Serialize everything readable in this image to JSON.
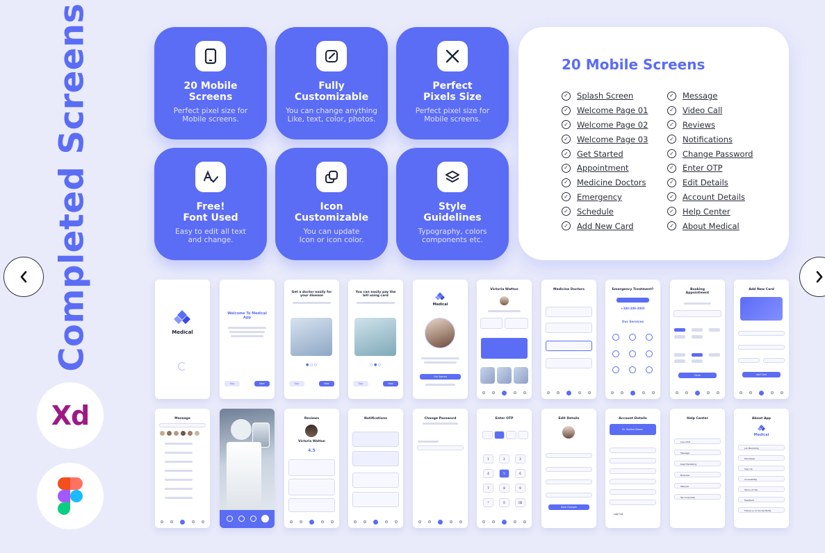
{
  "page_title": "Completed Screens",
  "nav": {
    "prev_symbol": "‹",
    "next_symbol": "›"
  },
  "tools": {
    "xd_label": "Xd"
  },
  "features": [
    {
      "title_line1": "20 Mobile",
      "title_line2": "Screens",
      "sub_line1": "Perfect pixel size for",
      "sub_line2": "Mobile screens.",
      "icon": "tablet-icon"
    },
    {
      "title_line1": "Fully",
      "title_line2": "Customizable",
      "sub_line1": "You can change anything",
      "sub_line2": "Like, text, color, photos.",
      "icon": "edit-icon"
    },
    {
      "title_line1": "Perfect",
      "title_line2": "Pixels Size",
      "sub_line1": "Perfect pixel size for",
      "sub_line2": "Mobile screens.",
      "icon": "arrows-in-icon"
    },
    {
      "title_line1": "Free!",
      "title_line2": "Font Used",
      "sub_line1": "Easy to edit all text",
      "sub_line2": "and change.",
      "icon": "font-icon"
    },
    {
      "title_line1": "Icon",
      "title_line2": "Customizable",
      "sub_line1": "You can update",
      "sub_line2": "Icon or icon color.",
      "icon": "copy-icon"
    },
    {
      "title_line1": "Style",
      "title_line2": "Guidelines",
      "sub_line1": "Typography, colors",
      "sub_line2": "components etc.",
      "icon": "layers-icon"
    }
  ],
  "screens_list": {
    "title": "20 Mobile Screens",
    "col1": [
      "Splash Screen",
      "Welcome Page 01",
      "Welcome Page 02",
      "Welcome Page 03",
      "Get Started",
      "Appointment",
      "Medicine Doctors",
      "Emergency",
      "Schedule",
      "Add New Card"
    ],
    "col2": [
      "Message",
      "Video Call",
      "Reviews",
      "Notifications",
      "Change Password",
      "Enter OTP",
      "Edit Details",
      "Account Details",
      "Help Center",
      "About Medical"
    ]
  },
  "mockups": {
    "splash_brand": "Medical",
    "welcome1_title": "Welcome To Medical App",
    "welcome2_title": "Get a doctor easily for your disease",
    "welcome3_title": "You can easily pay the bill using card",
    "get_started_brand": "Medical",
    "get_started_btn": "Get Started",
    "skip": "Skip",
    "next": "Next",
    "appointment_name": "Victoria Watton",
    "medicine_title": "Medicine Doctors",
    "emergency_title": "Emergency Treatment?",
    "emergency_phone": "+380-309-3005",
    "emergency_services": "Our Services",
    "schedule_title": "Booking Appointment",
    "schedule_btn": "Done",
    "add_card_title": "Add New Card",
    "add_card_btn": "Add Card",
    "message_title": "Message",
    "reviews_title": "Reviews",
    "reviews_name": "Victoria Watton",
    "reviews_rating": "4.5",
    "notifications_title": "Notifications",
    "change_password_title": "Change Password",
    "otp_title": "Enter OTP",
    "otp_digits": [
      "1",
      "2",
      "3",
      "4",
      "5",
      "6",
      "7",
      "8",
      "9",
      "*",
      "0",
      "⌫"
    ],
    "edit_details_title": "Edit Details",
    "edit_details_btn": "Save Changes",
    "account_title": "Account Details",
    "account_name": "Dr. Vonline Brown",
    "account_logout": "Log Out",
    "help_title": "Help Center",
    "help_items": [
      "Live Chat",
      "Message",
      "Dept Marketing",
      "Business",
      "Web Job",
      "Tax Corporate"
    ],
    "about_title": "About App",
    "about_brand": "Medical",
    "about_items": [
      "Job Marketing",
      "Developer",
      "Sign Up",
      "Accessibility",
      "Terms of Use",
      "Feedback",
      "Follow us on Social Media"
    ]
  },
  "colors": {
    "accent": "#5b6cf5",
    "background": "#e9ebfb",
    "card": "#ffffff"
  }
}
